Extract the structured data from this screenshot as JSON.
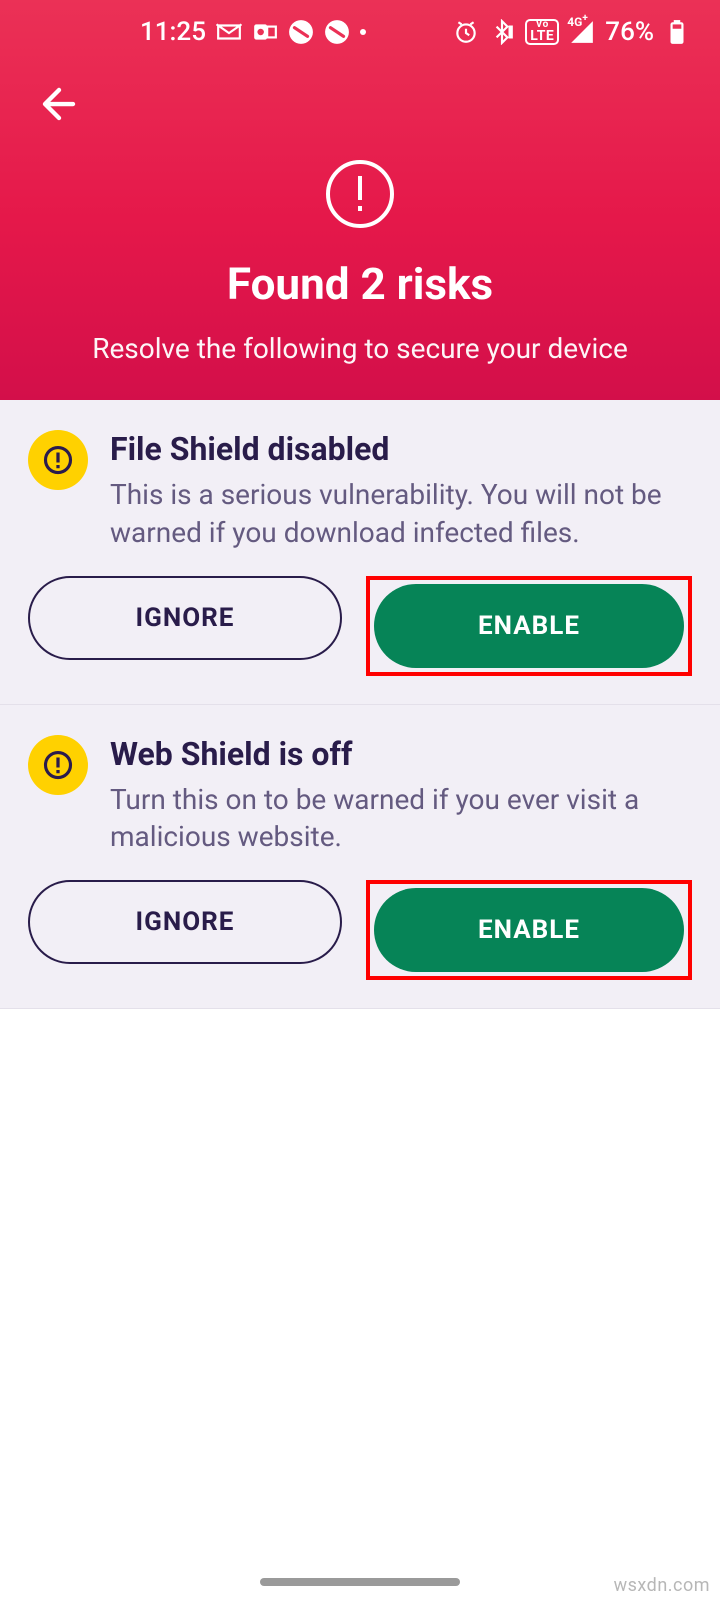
{
  "status": {
    "time": "11:25",
    "battery": "76%"
  },
  "hero": {
    "title": "Found 2 risks",
    "subtitle": "Resolve the following to secure your device"
  },
  "cards": [
    {
      "title": "File Shield disabled",
      "desc": "This is a serious vulnerability. You will not be warned if you download infected files.",
      "ignore": "IGNORE",
      "enable": "ENABLE"
    },
    {
      "title": "Web Shield is off",
      "desc": "Turn this on to be warned if you ever visit a malicious website.",
      "ignore": "IGNORE",
      "enable": "ENABLE"
    }
  ],
  "watermark": "wsxdn.com"
}
